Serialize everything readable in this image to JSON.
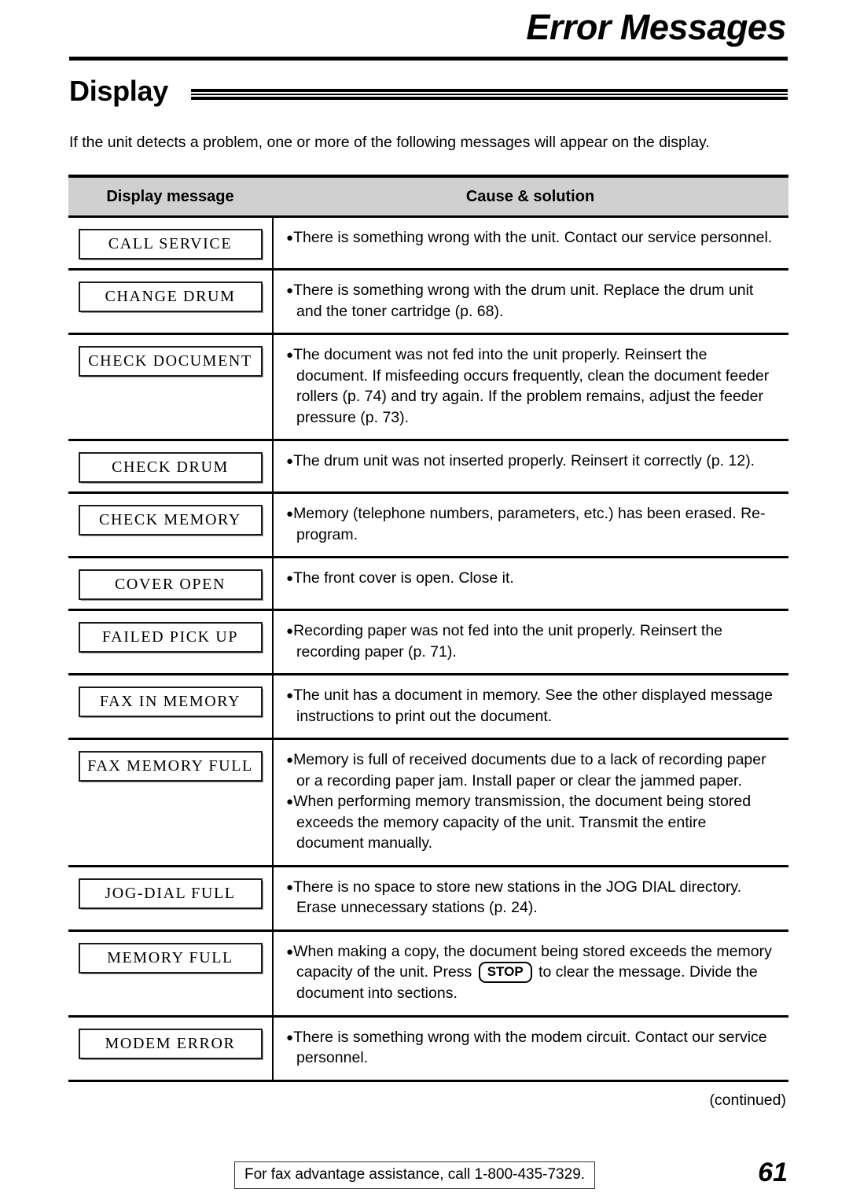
{
  "header": {
    "chapter_title": "Error Messages",
    "section_title": "Display"
  },
  "intro": "If the unit detects a problem, one or more of the following messages will appear on the display.",
  "table": {
    "columns": {
      "message": "Display message",
      "cause": "Cause & solution"
    },
    "rows": [
      {
        "message": "CALL SERVICE",
        "bullets": [
          "There is something wrong with the unit. Contact our service personnel."
        ]
      },
      {
        "message": "CHANGE DRUM",
        "bullets": [
          "There is something wrong with the drum unit. Replace the drum unit and the toner cartridge (p. 68)."
        ]
      },
      {
        "message": "CHECK DOCUMENT",
        "bullets": [
          "The document was not fed into the unit properly. Reinsert the document. If misfeeding occurs frequently, clean the document feeder rollers (p. 74) and try again. If the problem remains, adjust the feeder pressure (p. 73)."
        ]
      },
      {
        "message": "CHECK DRUM",
        "bullets": [
          "The drum unit was not inserted properly. Reinsert it correctly (p. 12)."
        ]
      },
      {
        "message": "CHECK MEMORY",
        "bullets": [
          "Memory (telephone numbers, parameters, etc.) has been erased. Re-program."
        ]
      },
      {
        "message": "COVER OPEN",
        "bullets": [
          "The front cover is open. Close it."
        ]
      },
      {
        "message": "FAILED PICK UP",
        "bullets": [
          "Recording paper was not fed into the unit properly. Reinsert the recording paper (p. 71)."
        ]
      },
      {
        "message": "FAX IN MEMORY",
        "bullets": [
          "The unit has a document in memory. See the other displayed message instructions to print out the document."
        ]
      },
      {
        "message": "FAX MEMORY FULL",
        "bullets": [
          "Memory is full of received documents due to a lack of recording paper or a recording paper jam. Install paper or clear the jammed paper.",
          "When performing memory transmission, the document being stored exceeds the memory capacity of the unit. Transmit the entire document manually."
        ]
      },
      {
        "message": "JOG-DIAL FULL",
        "bullets": [
          "There is no space to store new stations in the JOG DIAL directory. Erase unnecessary stations (p. 24)."
        ]
      },
      {
        "message": "MEMORY FULL",
        "bullets_rich": [
          {
            "before": "When making a copy, the document being stored exceeds the memory capacity of the unit. Press",
            "key": "STOP",
            "after": "to clear the message. Divide the document into sections."
          }
        ]
      },
      {
        "message": "MODEM ERROR",
        "bullets": [
          "There is something wrong with the modem circuit. Contact our service personnel."
        ]
      }
    ]
  },
  "footer": {
    "continued": "(continued)",
    "fax_notice": "For fax advantage assistance, call 1-800-435-7329.",
    "page_number": "61"
  }
}
